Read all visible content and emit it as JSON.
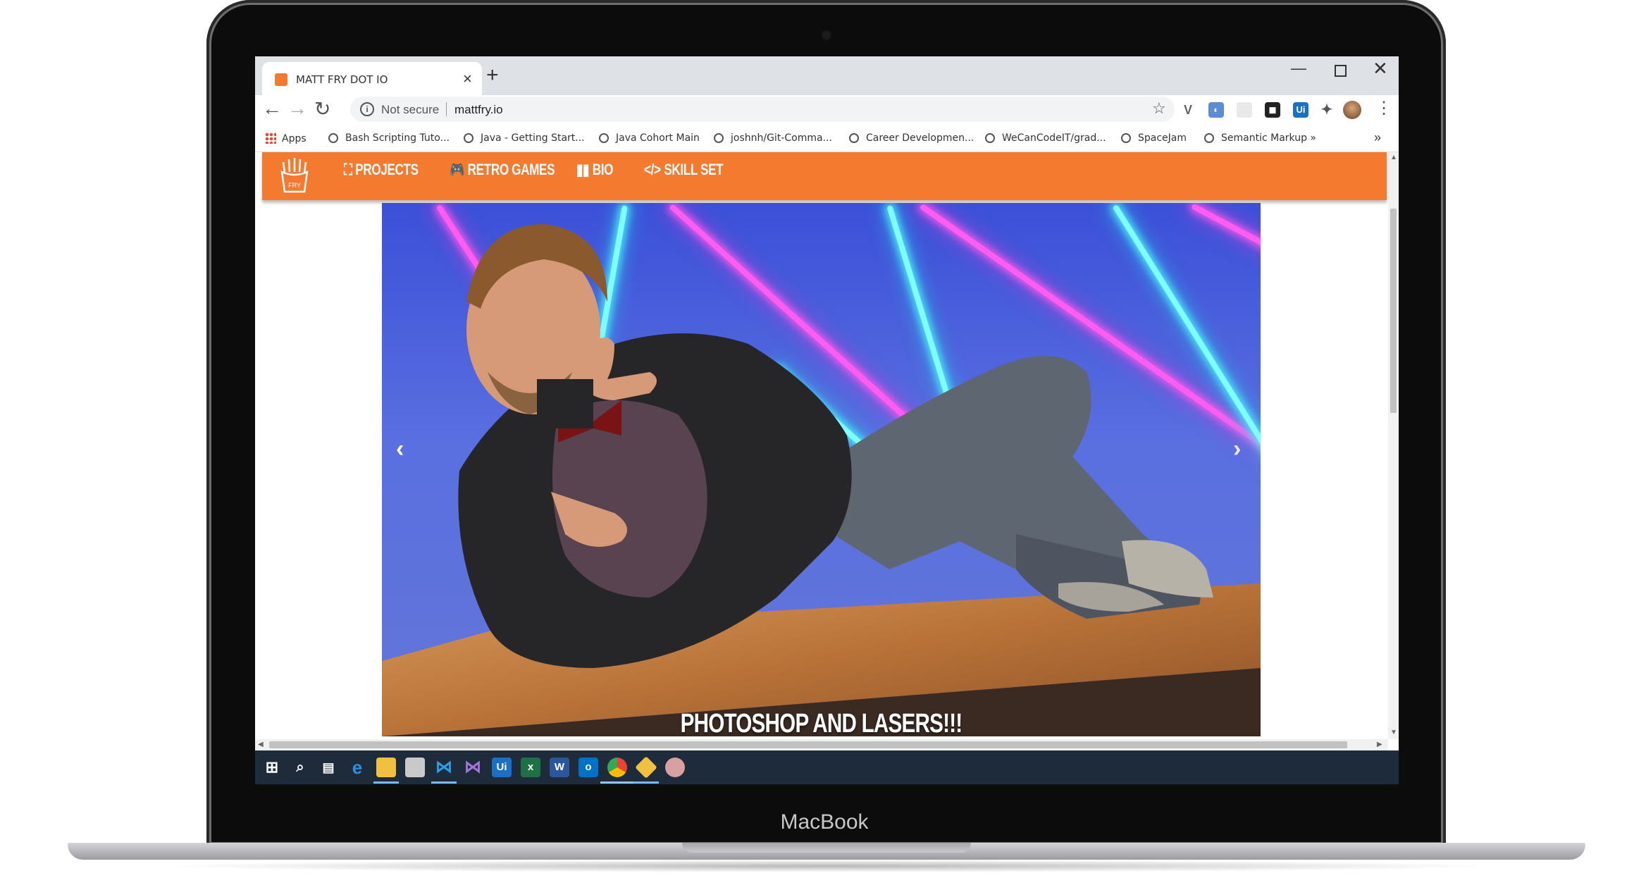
{
  "device": {
    "brand_label": "MacBook"
  },
  "browser": {
    "tab": {
      "title": "MATT FRY DOT IO",
      "close_icon": "×"
    },
    "new_tab_icon": "+",
    "window_controls": {
      "minimize": "—",
      "close": "✕"
    },
    "nav": {
      "back": "←",
      "forward": "→",
      "reload": "↻"
    },
    "omnibox": {
      "security_text": "Not secure",
      "url": "mattfry.io"
    },
    "star_icon": "☆",
    "extensions": [
      "V",
      "◐",
      "",
      "◼",
      "Ui",
      "✦"
    ],
    "menu_icon": "⋮",
    "bookmarks": {
      "apps_label": "Apps",
      "items": [
        "Bash Scripting Tuto...",
        "Java - Getting Start...",
        "Java Cohort Main",
        "joshnh/Git-Comma...",
        "Career Developmen...",
        "WeCanCodeIT/grad...",
        "SpaceJam",
        "Semantic Markup"
      ],
      "overflow": "»"
    }
  },
  "site": {
    "accent_color": "#f47a30",
    "logo_text": "FRY",
    "nav": [
      {
        "label": "PROJECTS",
        "icon": "sitemap-icon"
      },
      {
        "label": "RETRO GAMES",
        "icon": "gamepad-icon"
      },
      {
        "label": "BIO",
        "icon": "book-icon"
      },
      {
        "label": "SKILL SET",
        "icon": "code-icon"
      }
    ],
    "carousel": {
      "caption": "PHOTOSHOP AND LASERS!!!",
      "prev_icon": "‹",
      "next_icon": "›"
    }
  },
  "taskbar": {
    "items": [
      "start-icon",
      "search-icon",
      "task-view-icon",
      "edge-icon",
      "file-explorer-icon",
      "app-icon",
      "vscode-icon",
      "visual-studio-icon",
      "uipath-icon",
      "excel-icon",
      "word-icon",
      "outlook-icon",
      "chrome-icon",
      "git-icon",
      "paint-icon"
    ],
    "labels": {
      "uipath": "Ui",
      "excel": "x",
      "word": "W",
      "outlook": "o"
    }
  }
}
